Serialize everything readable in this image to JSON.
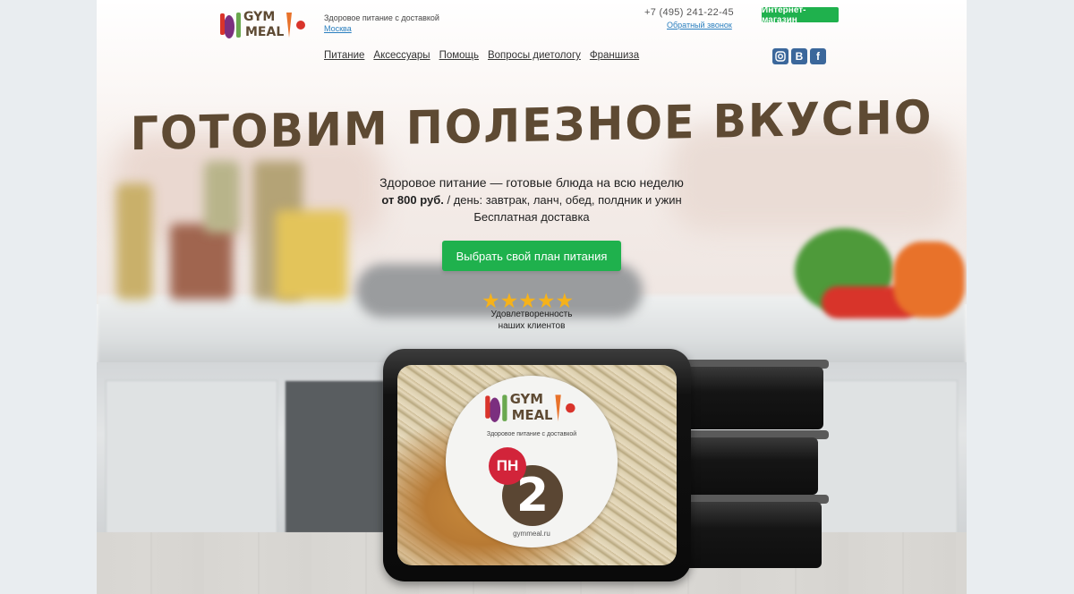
{
  "brand": {
    "word1": "GYM",
    "word2": "MEAL"
  },
  "header": {
    "tagline": "Здоровое питание с доставкой",
    "city": "Москва",
    "phone": "+7 (495) 241-22-45",
    "callback": "Обратный звонок",
    "shop_button": "Интернет-магазин"
  },
  "nav": {
    "items": [
      "Питание",
      "Аксессуары",
      "Помощь",
      "Вопросы диетологу",
      "Франшиза"
    ]
  },
  "social": {
    "icons": [
      "instagram-icon",
      "vk-icon",
      "facebook-icon"
    ],
    "vk": "В",
    "fb": "f"
  },
  "hero": {
    "headline": "ГОТОВИМ ПОЛЕЗНОЕ ВКУСНО",
    "line1": "Здоровое питание — готовые блюда на всю неделю",
    "price_bold": "от 800 руб.",
    "price_rest": " / день: завтрак, ланч, обед, полдник и ужин",
    "line3": "Бесплатная доставка",
    "cta": "Выбрать свой план питания",
    "stars": "★★★★★",
    "rating_value": 5,
    "rating_line1": "Удовлетворенность",
    "rating_line2": "наших клиентов"
  },
  "container_label": {
    "tagline": "Здоровое питание с доставкой",
    "day": "ПН",
    "number": "2",
    "url": "gymmeal.ru"
  },
  "colors": {
    "accent_green": "#1fb14d",
    "headline_brown": "#5e4a33",
    "link_blue": "#2a7fbf",
    "label_red": "#d2243a"
  }
}
